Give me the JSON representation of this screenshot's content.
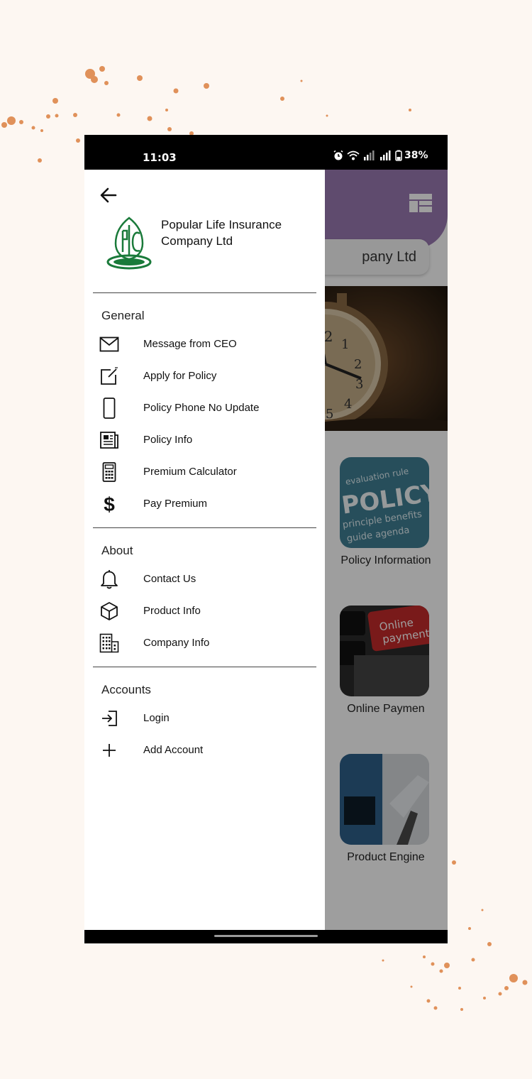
{
  "status_bar": {
    "time": "11:03",
    "battery": "38%",
    "icons": [
      "alarm-icon",
      "wifi-icon",
      "signal-icon",
      "signal-icon",
      "battery-icon"
    ]
  },
  "background_app": {
    "company_pill_text": "pany Ltd",
    "tiles": [
      {
        "label": "Policy Information",
        "image": "policy-word-cloud"
      },
      {
        "label": "Online Paymen",
        "image": "online-payment-keyboard"
      },
      {
        "label": "Product Engine",
        "image": "factory-robots"
      }
    ],
    "banner_image": "alarm-clock",
    "header_color": "#9a79b2"
  },
  "drawer": {
    "back_icon": "back-arrow-icon",
    "company_name": "Popular Life Insurance Company Ltd",
    "logo_color": "#1a7a3a",
    "sections": [
      {
        "title": "General",
        "items": [
          {
            "label": "Message from CEO",
            "icon": "mail-icon"
          },
          {
            "label": "Apply for Policy",
            "icon": "edit-icon"
          },
          {
            "label": "Policy Phone No Update",
            "icon": "phone-icon"
          },
          {
            "label": "Policy Info",
            "icon": "newspaper-icon"
          },
          {
            "label": "Premium Calculator",
            "icon": "calculator-icon"
          },
          {
            "label": "Pay Premium",
            "icon": "dollar-icon"
          }
        ]
      },
      {
        "title": "About",
        "items": [
          {
            "label": "Contact Us",
            "icon": "bell-icon"
          },
          {
            "label": "Product Info",
            "icon": "box-icon"
          },
          {
            "label": "Company Info",
            "icon": "building-icon"
          }
        ]
      },
      {
        "title": "Accounts",
        "items": [
          {
            "label": "Login",
            "icon": "login-icon"
          },
          {
            "label": "Add Account",
            "icon": "plus-icon"
          }
        ]
      }
    ]
  }
}
